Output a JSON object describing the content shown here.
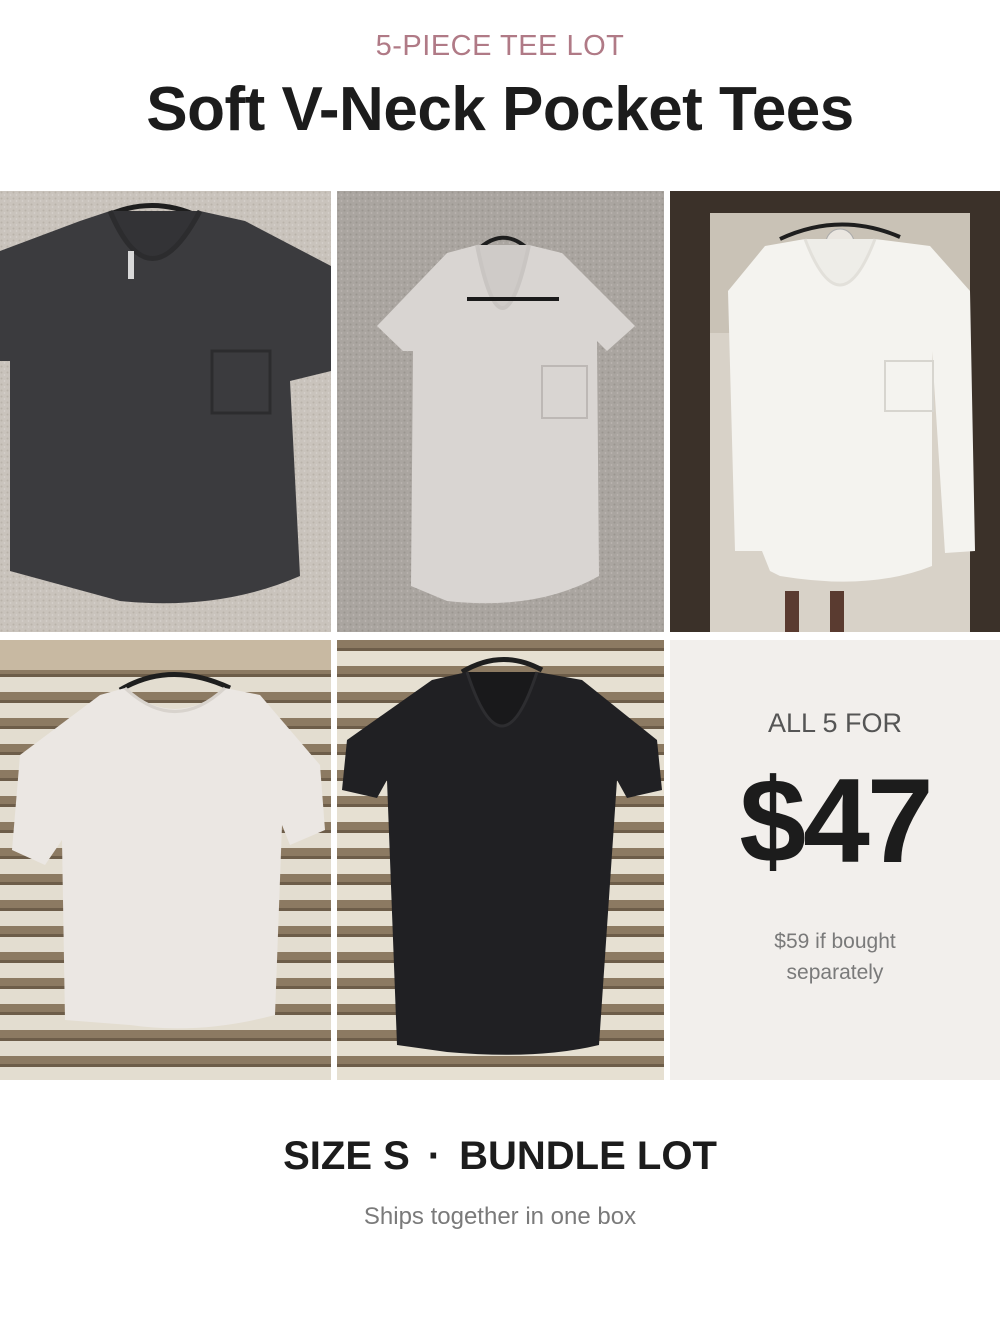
{
  "header": {
    "kicker": "5-PIECE TEE LOT",
    "title": "Soft V-Neck Pocket Tees"
  },
  "photos": [
    {
      "name": "charcoal-v-neck-pocket-tee",
      "background": "carpet",
      "tee_color": "#3a3a3c"
    },
    {
      "name": "heather-grey-v-neck-pocket-tee",
      "background": "carpet",
      "tee_color": "#dcd8d6"
    },
    {
      "name": "white-long-sleeve-pocket-tee",
      "background": "mirror",
      "tee_color": "#f3f2ee"
    },
    {
      "name": "white-scoop-neck-tee",
      "background": "window-blinds",
      "tee_color": "#e9e6e2"
    },
    {
      "name": "black-v-neck-tee",
      "background": "window-blinds",
      "tee_color": "#1f1f22"
    }
  ],
  "price_panel": {
    "label": "ALL 5 FOR",
    "price": "$47",
    "compare_line1": "$59 if bought",
    "compare_line2": "separately"
  },
  "footer": {
    "size": "SIZE S",
    "separator": "·",
    "type": "BUNDLE LOT",
    "subtitle": "Ships together in one box"
  },
  "colors": {
    "kicker": "#b07a86",
    "title": "#1c1c1c",
    "price_panel_bg": "#f2efec"
  }
}
